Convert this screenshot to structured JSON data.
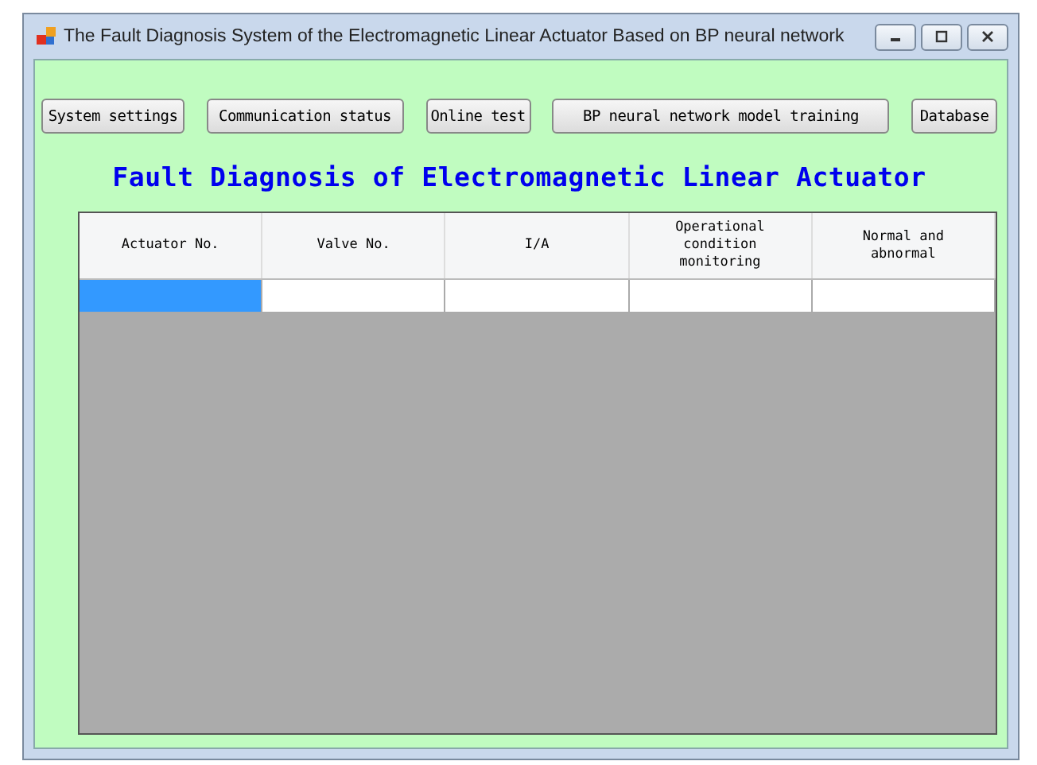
{
  "window": {
    "title": "The Fault Diagnosis System of the Electromagnetic Linear Actuator Based on BP neural network"
  },
  "toolbar": [
    "System settings",
    "Communication status",
    "Online test",
    "BP neural network model training",
    "Database"
  ],
  "heading": "Fault Diagnosis of Electromagnetic Linear Actuator",
  "table": {
    "columns": [
      "Actuator No.",
      "Valve No.",
      "I/A",
      "Operational condition monitoring",
      "Normal and abnormal"
    ],
    "rows": [
      {
        "cells": [
          {
            "selected": true
          },
          {
            "selected": false
          },
          {
            "selected": false
          },
          {
            "selected": false
          },
          {
            "selected": false
          }
        ]
      }
    ]
  }
}
